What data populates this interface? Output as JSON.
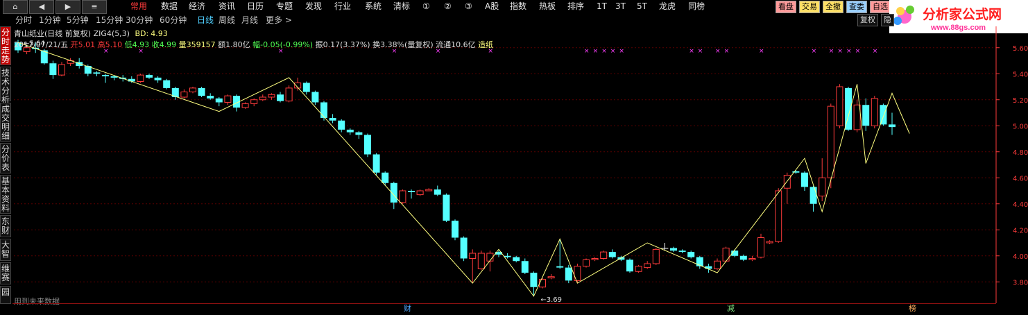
{
  "toolbar": {
    "nav_buttons": [
      "⌂",
      "◀",
      "▶",
      "≡"
    ],
    "menu": [
      "常用",
      "数据",
      "经济",
      "资讯",
      "日历",
      "专题",
      "发现",
      "行业",
      "系统",
      "清标",
      "①",
      "②",
      "③",
      "A股",
      "指数",
      "热板",
      "排序",
      "1T",
      "3T",
      "5T",
      "龙虎",
      "同榜"
    ],
    "active_menu": "常用",
    "right_buttons": [
      {
        "label": "看盘",
        "bg": "#ff9a9a"
      },
      {
        "label": "交易",
        "bg": "#ffe066"
      },
      {
        "label": "全撤",
        "bg": "#ffe066"
      },
      {
        "label": "查委",
        "bg": "#9ad0ff"
      },
      {
        "label": "自选",
        "bg": "#ff9a9a"
      }
    ]
  },
  "periods": [
    "分时",
    "1分钟",
    "5分钟",
    "15分钟",
    "30分钟",
    "60分钟",
    "日线",
    "周线",
    "月线",
    "更多 >"
  ],
  "active_period": "日线",
  "sidebar": [
    "分时走势",
    "技术分析",
    "成交明细",
    "分价表",
    "基本资料",
    "东财",
    "大智",
    "维赛",
    "园"
  ],
  "controls": {
    "fuquan": "复权",
    "hide": "隐"
  },
  "logo": {
    "title": "分析家公式网",
    "url": "www.88gs.com"
  },
  "info": {
    "name": "青山纸业(日线 前复权)",
    "indicator": "ZIG4(5,3)",
    "bd_label": "BD:",
    "bd_value": "4.93",
    "date": "2017/07/21/五",
    "open": "开5.01",
    "high": "高5.10",
    "low": "低4.93",
    "close": "收4.99",
    "volume": "量359157",
    "amount": "额1.80亿",
    "change": "幅-0.05(-0.99%)",
    "amplitude": "振0.17(3.37%)",
    "turnover": "换3.38%(量复权)",
    "float": "流通10.6亿",
    "industry": "造纸"
  },
  "labels": {
    "max": "5.64",
    "min": "3.69"
  },
  "footer_note": "用到未来数据",
  "events": [
    {
      "label": "财",
      "color": "#4fa8ff"
    },
    {
      "label": "减",
      "color": "#7fe07f"
    },
    {
      "label": "榜",
      "color": "#ffb060"
    }
  ],
  "colors": {
    "up": "#ff3b3b",
    "down": "#54ffff",
    "zig": "#ffff80",
    "grid": "#5a0000",
    "axis": "#ff3b3b",
    "marker": "#ff40ff"
  },
  "chart_data": {
    "type": "candlestick",
    "y_ticks": [
      5.6,
      5.4,
      5.2,
      5.0,
      4.8,
      4.6,
      4.4,
      4.2,
      4.0,
      3.8
    ],
    "ylim": [
      3.7,
      5.7
    ],
    "candles": [
      [
        5.64,
        5.58,
        5.66,
        5.56
      ],
      [
        5.57,
        5.6,
        5.62,
        5.55
      ],
      [
        5.6,
        5.59,
        5.64,
        5.56
      ],
      [
        5.58,
        5.48,
        5.59,
        5.47
      ],
      [
        5.48,
        5.39,
        5.5,
        5.36
      ],
      [
        5.39,
        5.47,
        5.49,
        5.38
      ],
      [
        5.48,
        5.5,
        5.52,
        5.46
      ],
      [
        5.49,
        5.46,
        5.52,
        5.44
      ],
      [
        5.46,
        5.4,
        5.47,
        5.38
      ],
      [
        5.41,
        5.4,
        5.42,
        5.38
      ],
      [
        5.39,
        5.38,
        5.4,
        5.33
      ],
      [
        5.38,
        5.37,
        5.39,
        5.35
      ],
      [
        5.37,
        5.36,
        5.39,
        5.34
      ],
      [
        5.36,
        5.34,
        5.38,
        5.33
      ],
      [
        5.34,
        5.39,
        5.4,
        5.33
      ],
      [
        5.39,
        5.37,
        5.4,
        5.36
      ],
      [
        5.37,
        5.35,
        5.38,
        5.33
      ],
      [
        5.35,
        5.29,
        5.36,
        5.28
      ],
      [
        5.29,
        5.22,
        5.3,
        5.2
      ],
      [
        5.22,
        5.26,
        5.28,
        5.21
      ],
      [
        5.26,
        5.29,
        5.3,
        5.25
      ],
      [
        5.29,
        5.23,
        5.3,
        5.22
      ],
      [
        5.23,
        5.21,
        5.25,
        5.2
      ],
      [
        5.21,
        5.18,
        5.22,
        5.15
      ],
      [
        5.18,
        5.23,
        5.24,
        5.16
      ],
      [
        5.23,
        5.14,
        5.24,
        5.11
      ],
      [
        5.14,
        5.17,
        5.18,
        5.13
      ],
      [
        5.17,
        5.2,
        5.21,
        5.15
      ],
      [
        5.2,
        5.22,
        5.24,
        5.19
      ],
      [
        5.22,
        5.24,
        5.25,
        5.2
      ],
      [
        5.24,
        5.19,
        5.26,
        5.18
      ],
      [
        5.19,
        5.29,
        5.31,
        5.18
      ],
      [
        5.29,
        5.33,
        5.37,
        5.27
      ],
      [
        5.33,
        5.26,
        5.34,
        5.24
      ],
      [
        5.26,
        5.18,
        5.27,
        5.16
      ],
      [
        5.18,
        5.06,
        5.19,
        5.04
      ],
      [
        5.06,
        5.04,
        5.09,
        5.02
      ],
      [
        5.04,
        4.97,
        5.05,
        4.95
      ],
      [
        4.97,
        4.95,
        4.98,
        4.93
      ],
      [
        4.95,
        4.93,
        4.96,
        4.9
      ],
      [
        4.93,
        4.78,
        4.94,
        4.76
      ],
      [
        4.78,
        4.64,
        4.79,
        4.62
      ],
      [
        4.64,
        4.56,
        4.65,
        4.54
      ],
      [
        4.56,
        4.41,
        4.57,
        4.36
      ],
      [
        4.41,
        4.5,
        4.51,
        4.4
      ],
      [
        4.5,
        4.49,
        4.51,
        4.44
      ],
      [
        4.47,
        4.5,
        4.51,
        4.46
      ],
      [
        4.5,
        4.51,
        4.52,
        4.5
      ],
      [
        4.51,
        4.47,
        4.54,
        4.46
      ],
      [
        4.47,
        4.27,
        4.48,
        4.26
      ],
      [
        4.27,
        4.14,
        4.28,
        4.12
      ],
      [
        4.14,
        3.98,
        4.15,
        3.96
      ],
      [
        3.98,
        4.02,
        4.05,
        3.79
      ],
      [
        3.9,
        4.02,
        4.04,
        3.89
      ],
      [
        3.96,
        4.02,
        4.04,
        3.88
      ],
      [
        4.03,
        4.01,
        4.04,
        3.99
      ],
      [
        4.0,
        3.99,
        4.02,
        3.98
      ],
      [
        3.99,
        3.96,
        4.0,
        3.95
      ],
      [
        3.96,
        3.87,
        3.98,
        3.86
      ],
      [
        3.87,
        3.76,
        3.88,
        3.69
      ],
      [
        3.76,
        3.82,
        3.83,
        3.75
      ],
      [
        3.83,
        3.84,
        3.86,
        3.82
      ],
      [
        3.92,
        3.91,
        4.13,
        3.9
      ],
      [
        3.91,
        3.81,
        3.93,
        3.79
      ],
      [
        3.81,
        3.92,
        3.94,
        3.79
      ],
      [
        3.92,
        3.97,
        3.98,
        3.91
      ],
      [
        3.97,
        3.98,
        3.99,
        3.96
      ],
      [
        3.98,
        4.03,
        4.04,
        3.97
      ],
      [
        4.03,
        3.99,
        4.05,
        3.98
      ],
      [
        3.99,
        3.97,
        4.0,
        3.96
      ],
      [
        3.97,
        3.88,
        3.98,
        3.87
      ],
      [
        3.88,
        3.92,
        3.93,
        3.87
      ],
      [
        3.91,
        3.94,
        3.96,
        3.9
      ],
      [
        3.94,
        4.05,
        4.06,
        3.93
      ],
      [
        4.06,
        4.06,
        4.1,
        4.04
      ],
      [
        4.06,
        4.04,
        4.07,
        4.03
      ],
      [
        4.04,
        4.03,
        4.05,
        4.02
      ],
      [
        4.03,
        3.99,
        4.04,
        3.98
      ],
      [
        3.99,
        3.92,
        4.0,
        3.9
      ],
      [
        3.92,
        3.9,
        3.94,
        3.87
      ],
      [
        3.9,
        3.96,
        3.98,
        3.89
      ],
      [
        3.96,
        4.06,
        4.07,
        3.95
      ],
      [
        4.04,
        4.0,
        4.05,
        3.99
      ],
      [
        4.0,
        3.97,
        4.01,
        3.96
      ],
      [
        3.97,
        3.98,
        4.0,
        3.96
      ],
      [
        3.99,
        4.14,
        4.17,
        3.98
      ],
      [
        4.1,
        4.11,
        4.12,
        4.09
      ],
      [
        4.11,
        4.5,
        4.52,
        4.1
      ],
      [
        4.52,
        4.62,
        4.64,
        4.4
      ],
      [
        4.65,
        4.64,
        4.66,
        4.63
      ],
      [
        4.64,
        4.53,
        4.65,
        4.5
      ],
      [
        4.53,
        4.4,
        4.54,
        4.34
      ],
      [
        4.46,
        4.6,
        4.75,
        4.42
      ],
      [
        4.6,
        5.15,
        5.17,
        4.52
      ],
      [
        5.0,
        5.3,
        5.32,
        4.98
      ],
      [
        5.29,
        4.97,
        5.3,
        4.96
      ],
      [
        4.97,
        5.16,
        5.2,
        4.95
      ],
      [
        5.16,
        5.0,
        5.21,
        4.96
      ],
      [
        5.0,
        5.21,
        5.23,
        4.98
      ],
      [
        5.16,
        5.01,
        5.17,
        5.0
      ],
      [
        5.01,
        4.99,
        5.1,
        4.93
      ]
    ],
    "zig": [
      [
        0,
        5.64
      ],
      [
        23,
        5.11
      ],
      [
        31,
        5.37
      ],
      [
        52,
        3.79
      ],
      [
        55,
        4.05
      ],
      [
        59,
        3.69
      ],
      [
        62,
        4.13
      ],
      [
        64,
        3.79
      ],
      [
        72,
        4.1
      ],
      [
        80,
        3.87
      ],
      [
        90,
        4.75
      ],
      [
        92,
        4.34
      ],
      [
        96,
        5.32
      ],
      [
        97,
        4.71
      ],
      [
        100,
        5.25
      ],
      [
        102,
        4.94
      ]
    ],
    "markers": [
      10,
      14,
      30,
      43,
      48,
      54,
      65,
      66,
      67,
      68,
      69,
      77,
      78,
      80,
      81,
      85,
      91,
      93,
      94,
      95,
      96,
      98,
      104,
      105,
      107,
      108,
      109,
      110
    ]
  }
}
